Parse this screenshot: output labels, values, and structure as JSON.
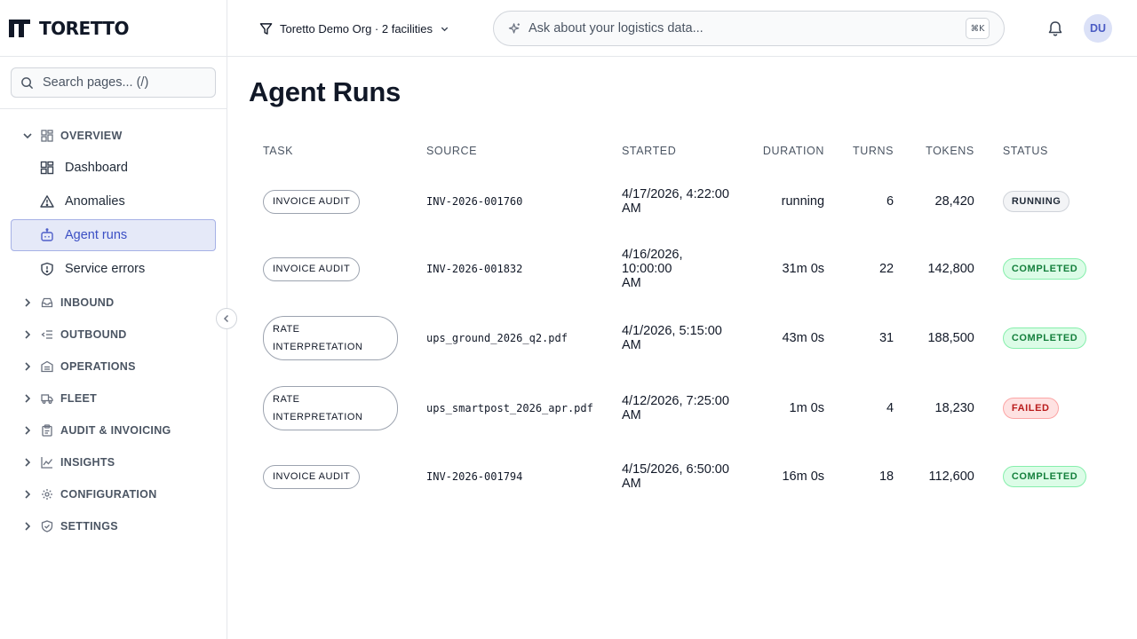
{
  "brand": {
    "name": "TORETTO"
  },
  "sidebar": {
    "search_placeholder": "Search pages...  (/)",
    "groups": [
      {
        "label": "OVERVIEW",
        "expanded": true,
        "icon": "layout-grid-icon",
        "items": [
          {
            "label": "Dashboard",
            "icon": "dashboard-icon",
            "active": false
          },
          {
            "label": "Anomalies",
            "icon": "warning-triangle-icon",
            "active": false
          },
          {
            "label": "Agent runs",
            "icon": "bot-icon",
            "active": true
          },
          {
            "label": "Service errors",
            "icon": "shield-alert-icon",
            "active": false
          }
        ]
      },
      {
        "label": "INBOUND",
        "expanded": false,
        "icon": "inbox-icon"
      },
      {
        "label": "OUTBOUND",
        "expanded": false,
        "icon": "outbound-list-icon"
      },
      {
        "label": "OPERATIONS",
        "expanded": false,
        "icon": "warehouse-icon"
      },
      {
        "label": "FLEET",
        "expanded": false,
        "icon": "truck-icon"
      },
      {
        "label": "AUDIT & INVOICING",
        "expanded": false,
        "icon": "clipboard-icon"
      },
      {
        "label": "INSIGHTS",
        "expanded": false,
        "icon": "line-chart-icon"
      },
      {
        "label": "CONFIGURATION",
        "expanded": false,
        "icon": "gear-icon"
      },
      {
        "label": "SETTINGS",
        "expanded": false,
        "icon": "shield-check-icon"
      }
    ]
  },
  "topbar": {
    "org_filter": "Toretto Demo Org · 2 facilities",
    "ask_placeholder": "Ask about your logistics data...",
    "ask_shortcut": "⌘K",
    "avatar_initials": "DU"
  },
  "page": {
    "title": "Agent Runs",
    "columns": [
      "TASK",
      "SOURCE",
      "STARTED",
      "DURATION",
      "TURNS",
      "TOKENS",
      "STATUS"
    ],
    "rows": [
      {
        "task": "INVOICE AUDIT",
        "source": "INV-2026-001760",
        "started_l1": "4/17/2026, 4:22:00",
        "started_l2": "AM",
        "duration": "running",
        "turns": "6",
        "tokens": "28,420",
        "status": "RUNNING",
        "status_kind": "running"
      },
      {
        "task": "INVOICE AUDIT",
        "source": "INV-2026-001832",
        "started_l1": "4/16/2026, 10:00:00",
        "started_l2": "AM",
        "duration": "31m 0s",
        "turns": "22",
        "tokens": "142,800",
        "status": "COMPLETED",
        "status_kind": "completed"
      },
      {
        "task_l1": "RATE",
        "task_l2": "INTERPRETATION",
        "source": "ups_ground_2026_q2.pdf",
        "started_l1": "4/1/2026, 5:15:00 AM",
        "started_l2": "",
        "duration": "43m 0s",
        "turns": "31",
        "tokens": "188,500",
        "status": "COMPLETED",
        "status_kind": "completed"
      },
      {
        "task_l1": "RATE",
        "task_l2": "INTERPRETATION",
        "source": "ups_smartpost_2026_apr.pdf",
        "started_l1": "4/12/2026, 7:25:00",
        "started_l2": "AM",
        "duration": "1m 0s",
        "turns": "4",
        "tokens": "18,230",
        "status": "FAILED",
        "status_kind": "failed"
      },
      {
        "task": "INVOICE AUDIT",
        "source": "INV-2026-001794",
        "started_l1": "4/15/2026, 6:50:00",
        "started_l2": "AM",
        "duration": "16m 0s",
        "turns": "18",
        "tokens": "112,600",
        "status": "COMPLETED",
        "status_kind": "completed"
      }
    ]
  },
  "colors": {
    "accent": "#4f5fc9",
    "active_bg": "#e5e9f8",
    "completed": "#15803d",
    "failed": "#b91c1c"
  }
}
